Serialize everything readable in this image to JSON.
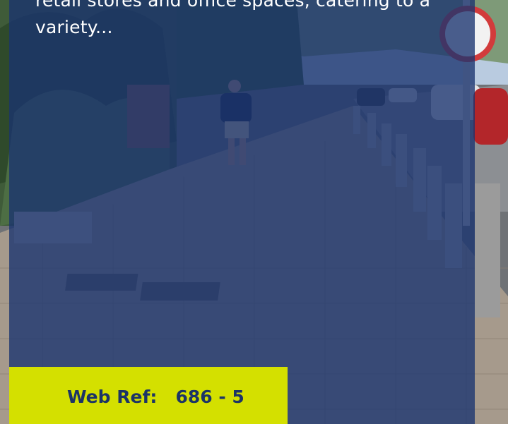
{
  "listing": {
    "description": "retail stores and office spaces, catering to a variety...",
    "web_ref_label": "Web Ref:",
    "web_ref_value": "686 - 5"
  },
  "photo": {
    "subject": "street-sidewalk-photo"
  },
  "colors": {
    "overlay": "#1a3370",
    "ref_box": "#d4e000",
    "ref_text": "#1c3466",
    "description_text": "#ffffff"
  }
}
